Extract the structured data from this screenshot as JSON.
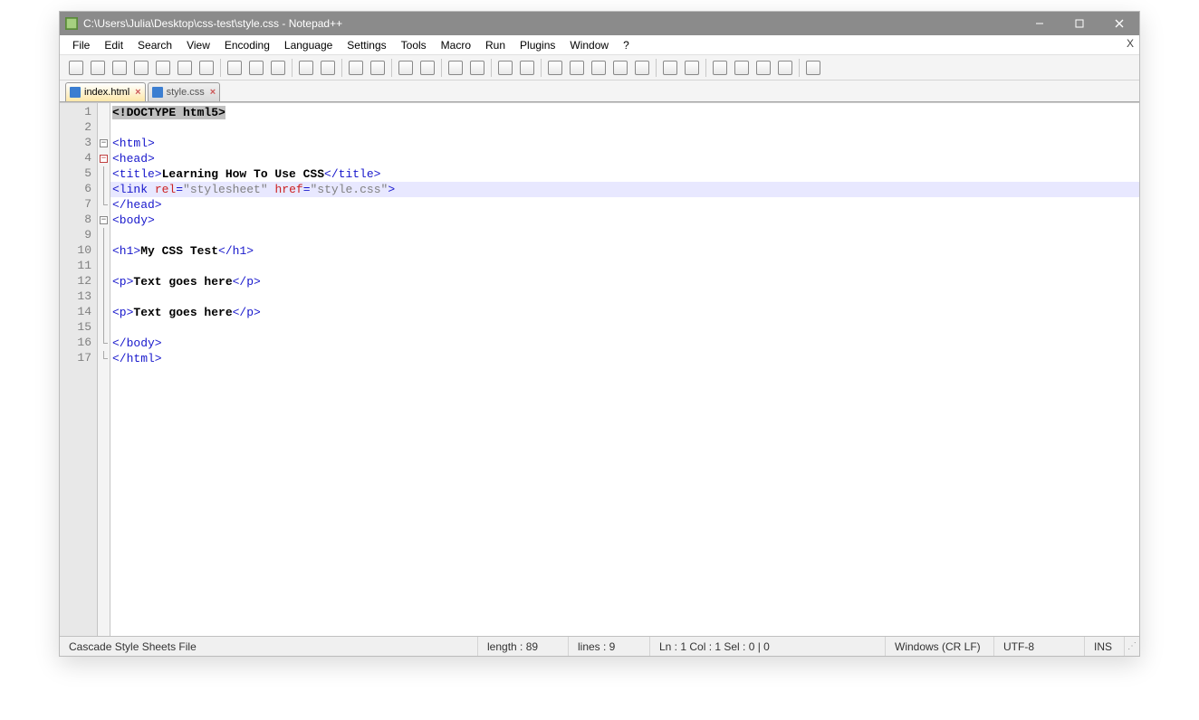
{
  "window": {
    "title": "C:\\Users\\Julia\\Desktop\\css-test\\style.css - Notepad++"
  },
  "menu": {
    "items": [
      "File",
      "Edit",
      "Search",
      "View",
      "Encoding",
      "Language",
      "Settings",
      "Tools",
      "Macro",
      "Run",
      "Plugins",
      "Window",
      "?"
    ]
  },
  "toolbar": {
    "icons": [
      "new",
      "open",
      "save",
      "save-all",
      "close",
      "close-all",
      "print",
      "cut",
      "copy",
      "paste",
      "undo",
      "redo",
      "find",
      "replace",
      "zoom-in",
      "zoom-out",
      "sync-v",
      "sync-h",
      "wrap",
      "show-all",
      "indent-guide",
      "lang",
      "fold",
      "unfold",
      "hide",
      "folder",
      "monitor",
      "record",
      "stop",
      "play",
      "play-multi",
      "abc"
    ]
  },
  "tabs": [
    {
      "label": "index.html",
      "active": true
    },
    {
      "label": "style.css",
      "active": false
    }
  ],
  "lines": {
    "count": 17,
    "highlight": 6
  },
  "code": [
    {
      "type": "doctype",
      "raw": "<!DOCTYPE html5>"
    },
    {
      "type": "blank"
    },
    {
      "type": "tag",
      "raw": "<html>"
    },
    {
      "type": "tag",
      "raw": "<head>"
    },
    {
      "type": "title",
      "open": "<title>",
      "text": "Learning How To Use CSS",
      "close": "</title>"
    },
    {
      "type": "link",
      "open": "<link ",
      "a1": "rel",
      "v1": "\"stylesheet\"",
      "a2": "href",
      "v2": "\"style.css\"",
      "close": ">"
    },
    {
      "type": "tag",
      "raw": "</head>"
    },
    {
      "type": "tag",
      "raw": "<body>"
    },
    {
      "type": "blank"
    },
    {
      "type": "el",
      "open": "<h1>",
      "text": "My CSS Test",
      "close": "</h1>"
    },
    {
      "type": "blank"
    },
    {
      "type": "el",
      "open": "<p>",
      "text": "Text goes here",
      "close": "</p>"
    },
    {
      "type": "blank"
    },
    {
      "type": "el",
      "open": "<p>",
      "text": "Text goes here",
      "close": "</p>"
    },
    {
      "type": "blank"
    },
    {
      "type": "tag",
      "raw": "</body>"
    },
    {
      "type": "tag",
      "raw": "</html>"
    }
  ],
  "status": {
    "filetype": "Cascade Style Sheets File",
    "length": "length : 89",
    "lines": "lines : 9",
    "pos": "Ln : 1   Col : 1   Sel : 0 | 0",
    "eol": "Windows (CR LF)",
    "enc": "UTF-8",
    "mode": "INS"
  }
}
